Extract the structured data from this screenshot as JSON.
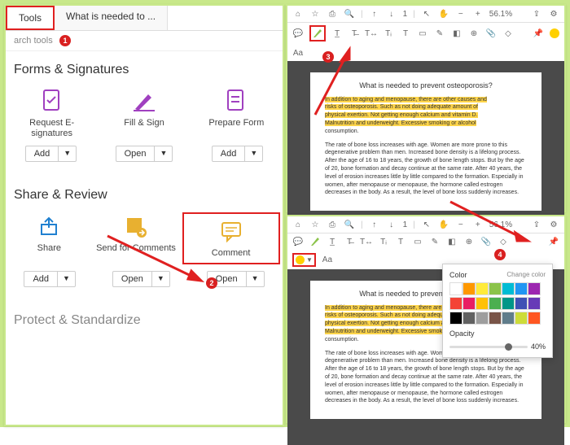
{
  "tabs": {
    "tools": "Tools",
    "doc": "What is needed to ..."
  },
  "search_placeholder": "arch tools",
  "sections": {
    "forms": "Forms & Signatures",
    "share": "Share & Review",
    "protect": "Protect & Standardize"
  },
  "tools": {
    "esig": "Request E-signatures",
    "fill": "Fill & Sign",
    "prepare": "Prepare Form",
    "share": "Share",
    "send": "Send for Comments",
    "comment": "Comment"
  },
  "buttons": {
    "add": "Add",
    "open": "Open"
  },
  "badges": {
    "b1": "1",
    "b2": "2",
    "b3": "3",
    "b4": "4"
  },
  "toolbar": {
    "zoom": "56.1%",
    "page": "1"
  },
  "doc": {
    "title": "What is needed to prevent osteoporosis?",
    "p1a": "In addition to aging and menopause, there are other causes and",
    "p1b": "risks of osteoporosis. Such as not doing adequate amount of",
    "p1c": "physical exertion. Not getting enough calcium and vitamin D.",
    "p1d": "Malnutrition and underweight. Excessive smoking or alcohol",
    "p1e": "consumption.",
    "p2": "The rate of bone loss increases with age. Women are more prone to this degenerative problem than men. Increased bone density is a lifelong process. After the age of 16 to 18 years, the growth of bone length stops. But by the age of 20, bone formation and decay continue at the same rate. After 40 years, the level of erosion increases little by little compared to the formation. Especially in women, after menopause or menopause, the hormone called estrogen decreases in the body. As a result, the level of bone loss suddenly increases."
  },
  "popup": {
    "color_label": "Color",
    "opacity_label": "Opacity",
    "opacity_value": "40%",
    "change": "Change color"
  },
  "colors": [
    "#ffffff",
    "#ff9800",
    "#ffeb3b",
    "#8bc34a",
    "#00bcd4",
    "#2196f3",
    "#9c27b0",
    "#f44336",
    "#e91e63",
    "#ffc107",
    "#4caf50",
    "#009688",
    "#3f51b5",
    "#673ab7",
    "#000000",
    "#616161",
    "#9e9e9e",
    "#795548",
    "#607d8b",
    "#cddc39",
    "#ff5722"
  ]
}
